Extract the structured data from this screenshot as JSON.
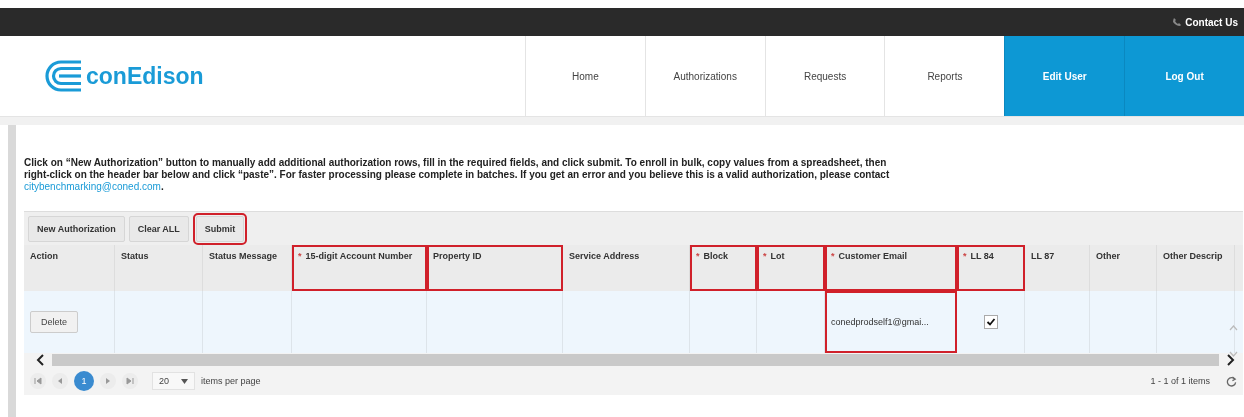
{
  "topbar": {
    "contact": "Contact Us"
  },
  "brand": {
    "name": "conEdison"
  },
  "nav": [
    {
      "label": "Home",
      "kind": "plain"
    },
    {
      "label": "Authorizations",
      "kind": "plain"
    },
    {
      "label": "Requests",
      "kind": "plain"
    },
    {
      "label": "Reports",
      "kind": "plain"
    },
    {
      "label": "Edit User",
      "kind": "accent"
    },
    {
      "label": "Log Out",
      "kind": "accent"
    }
  ],
  "instructions": {
    "text": "Click on “New Authorization” button to manually add additional authorization rows, fill in the required fields, and click submit. To enroll in bulk, copy values from a spreadsheet, then right-click on the header bar below and click “paste”. For faster processing please complete in batches. If you get an error and you believe this is a valid authorization, please contact ",
    "link": "citybenchmarking@coned.com",
    "end": "."
  },
  "toolbar": [
    {
      "label": "New Authorization",
      "highlighted": false
    },
    {
      "label": "Clear ALL",
      "highlighted": false
    },
    {
      "label": "Submit",
      "highlighted": true
    }
  ],
  "table": {
    "columns": [
      {
        "label": "Action",
        "highlighted": false
      },
      {
        "label": "Status",
        "highlighted": false
      },
      {
        "label": "Status Message",
        "highlighted": false
      },
      {
        "label": "15-digit Account Number",
        "marker": "*",
        "highlighted": true
      },
      {
        "label": "Property ID",
        "highlighted": true
      },
      {
        "label": "Service Address",
        "highlighted": false
      },
      {
        "label": "Block",
        "marker": "*",
        "highlighted": true
      },
      {
        "label": "Lot",
        "marker": "*",
        "highlighted": true
      },
      {
        "label": "Customer Email",
        "marker": "*",
        "highlighted": true
      },
      {
        "label": "LL 84",
        "marker": "*",
        "highlighted": true
      },
      {
        "label": "LL 87",
        "highlighted": false
      },
      {
        "label": "Other",
        "highlighted": false
      },
      {
        "label": "Other Descrip",
        "highlighted": false
      }
    ],
    "rows": [
      {
        "cells": [
          {
            "kind": "button",
            "text": "Delete"
          },
          {
            "kind": "empty"
          },
          {
            "kind": "empty"
          },
          {
            "kind": "empty"
          },
          {
            "kind": "empty"
          },
          {
            "kind": "empty"
          },
          {
            "kind": "empty"
          },
          {
            "kind": "empty"
          },
          {
            "kind": "text",
            "text": "conedprodself1@gmai...",
            "highlighted": true
          },
          {
            "kind": "checkbox",
            "checked": true
          },
          {
            "kind": "empty"
          },
          {
            "kind": "empty"
          },
          {
            "kind": "empty"
          }
        ]
      }
    ]
  },
  "pager": {
    "pages": [
      {
        "label": "1",
        "selected": true
      }
    ],
    "page_size": "20",
    "page_size_label": "items per page",
    "summary": "1 - 1 of 1 items"
  }
}
